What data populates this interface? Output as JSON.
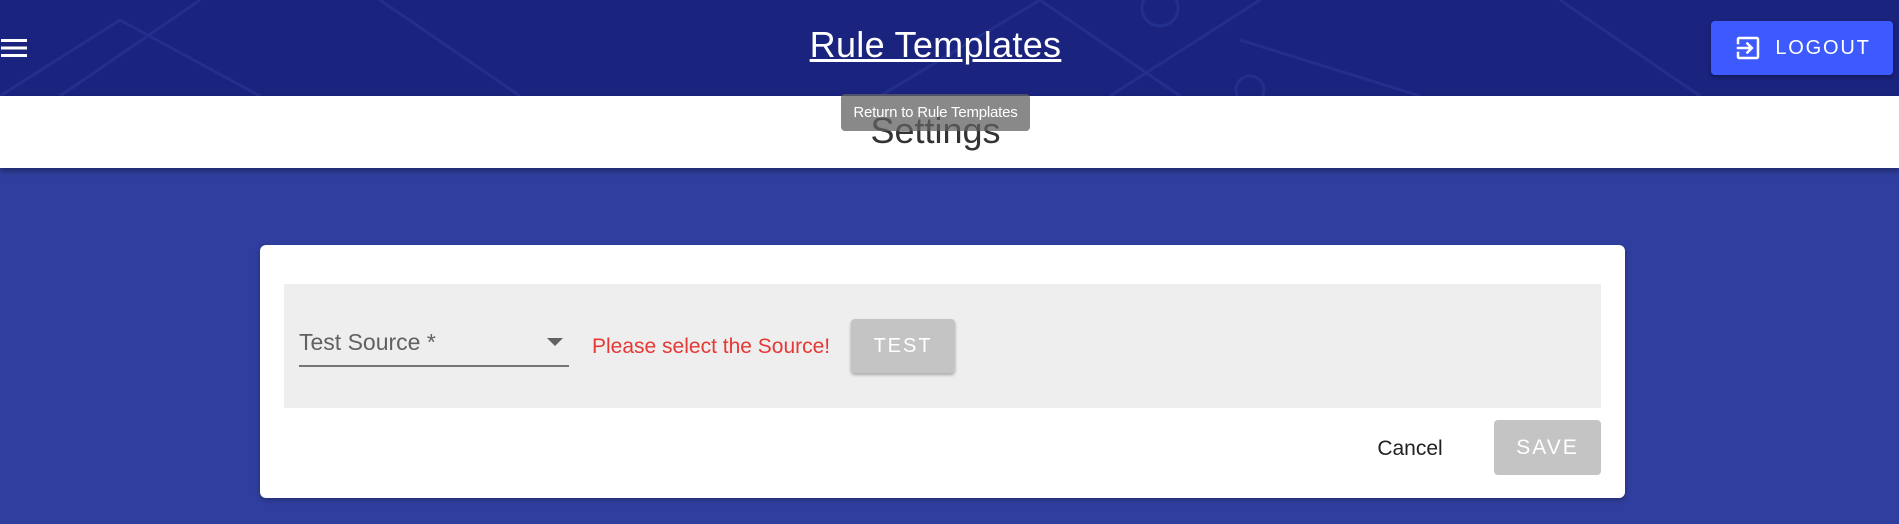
{
  "header": {
    "menu_icon": "hamburger-menu-icon",
    "title": "Rule Templates",
    "logout_label": "LOGOUT",
    "logout_icon": "exit-to-app-icon"
  },
  "subheader": {
    "title": "Settings"
  },
  "tooltip": {
    "text": "Return to Rule Templates"
  },
  "form": {
    "source_select_label": "Test Source *",
    "error_message": "Please select the Source!",
    "test_button_label": "TEST",
    "cancel_button_label": "Cancel",
    "save_button_label": "SAVE"
  },
  "colors": {
    "appbar": "#1a237e",
    "background": "#303f9f",
    "logout_button": "#3d5afe",
    "error": "#e53935",
    "disabled_button": "#c4c4c4"
  }
}
